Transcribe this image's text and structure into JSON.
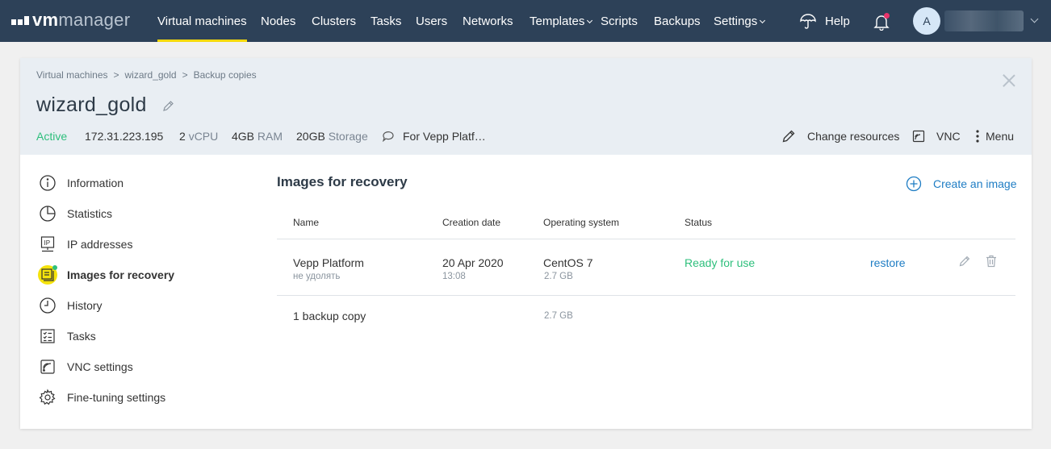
{
  "brand": {
    "vm": "vm",
    "manager": "manager"
  },
  "nav": {
    "items": [
      {
        "label": "Virtual machines",
        "active": true
      },
      {
        "label": "Nodes"
      },
      {
        "label": "Clusters"
      },
      {
        "label": "Tasks"
      },
      {
        "label": "Users"
      },
      {
        "label": "Networks"
      },
      {
        "label": "Templates",
        "dropdown": true
      },
      {
        "label": "Scripts"
      },
      {
        "label": "Backups"
      },
      {
        "label": "Settings",
        "dropdown": true
      }
    ],
    "help": "Help",
    "avatar_initial": "A"
  },
  "breadcrumb": [
    "Virtual machines",
    "wizard_gold",
    "Backup copies"
  ],
  "breadcrumb_sep": ">",
  "vm": {
    "name": "wizard_gold",
    "status": "Active",
    "ip": "172.31.223.195",
    "cpu_value": "2",
    "cpu_unit": "vCPU",
    "ram_value": "4GB",
    "ram_unit": "RAM",
    "storage_value": "20GB",
    "storage_unit": "Storage",
    "comment": "For Vepp Platf…"
  },
  "head_actions": {
    "change_resources": "Change resources",
    "vnc": "VNC",
    "menu": "Menu"
  },
  "sidebar": {
    "items": [
      {
        "label": "Information",
        "icon": "info-icon"
      },
      {
        "label": "Statistics",
        "icon": "pie-chart-icon"
      },
      {
        "label": "IP addresses",
        "icon": "ip-icon"
      },
      {
        "label": "Images for recovery",
        "icon": "image-stack-icon",
        "selected": true
      },
      {
        "label": "History",
        "icon": "clock-icon"
      },
      {
        "label": "Tasks",
        "icon": "checklist-icon"
      },
      {
        "label": "VNC settings",
        "icon": "vnc-icon"
      },
      {
        "label": "Fine-tuning settings",
        "icon": "gear-icon"
      }
    ]
  },
  "main": {
    "title": "Images for recovery",
    "create_label": "Create an image",
    "columns": [
      "Name",
      "Creation date",
      "Operating system",
      "Status"
    ],
    "rows": [
      {
        "name": "Vepp Platform",
        "note": "не удолять",
        "date": "20 Apr 2020",
        "time": "13:08",
        "os": "CentOS 7",
        "size": "2.7 GB",
        "status": "Ready for use",
        "action": "restore"
      }
    ],
    "summary": {
      "count_label": "1 backup copy",
      "total_size": "2.7 GB"
    }
  },
  "colors": {
    "topbar": "#2d4158",
    "accent_yellow": "#f5d90c",
    "link_blue": "#1f7dc4",
    "status_green": "#2ebf7c",
    "header_bg": "#e9eef3"
  }
}
